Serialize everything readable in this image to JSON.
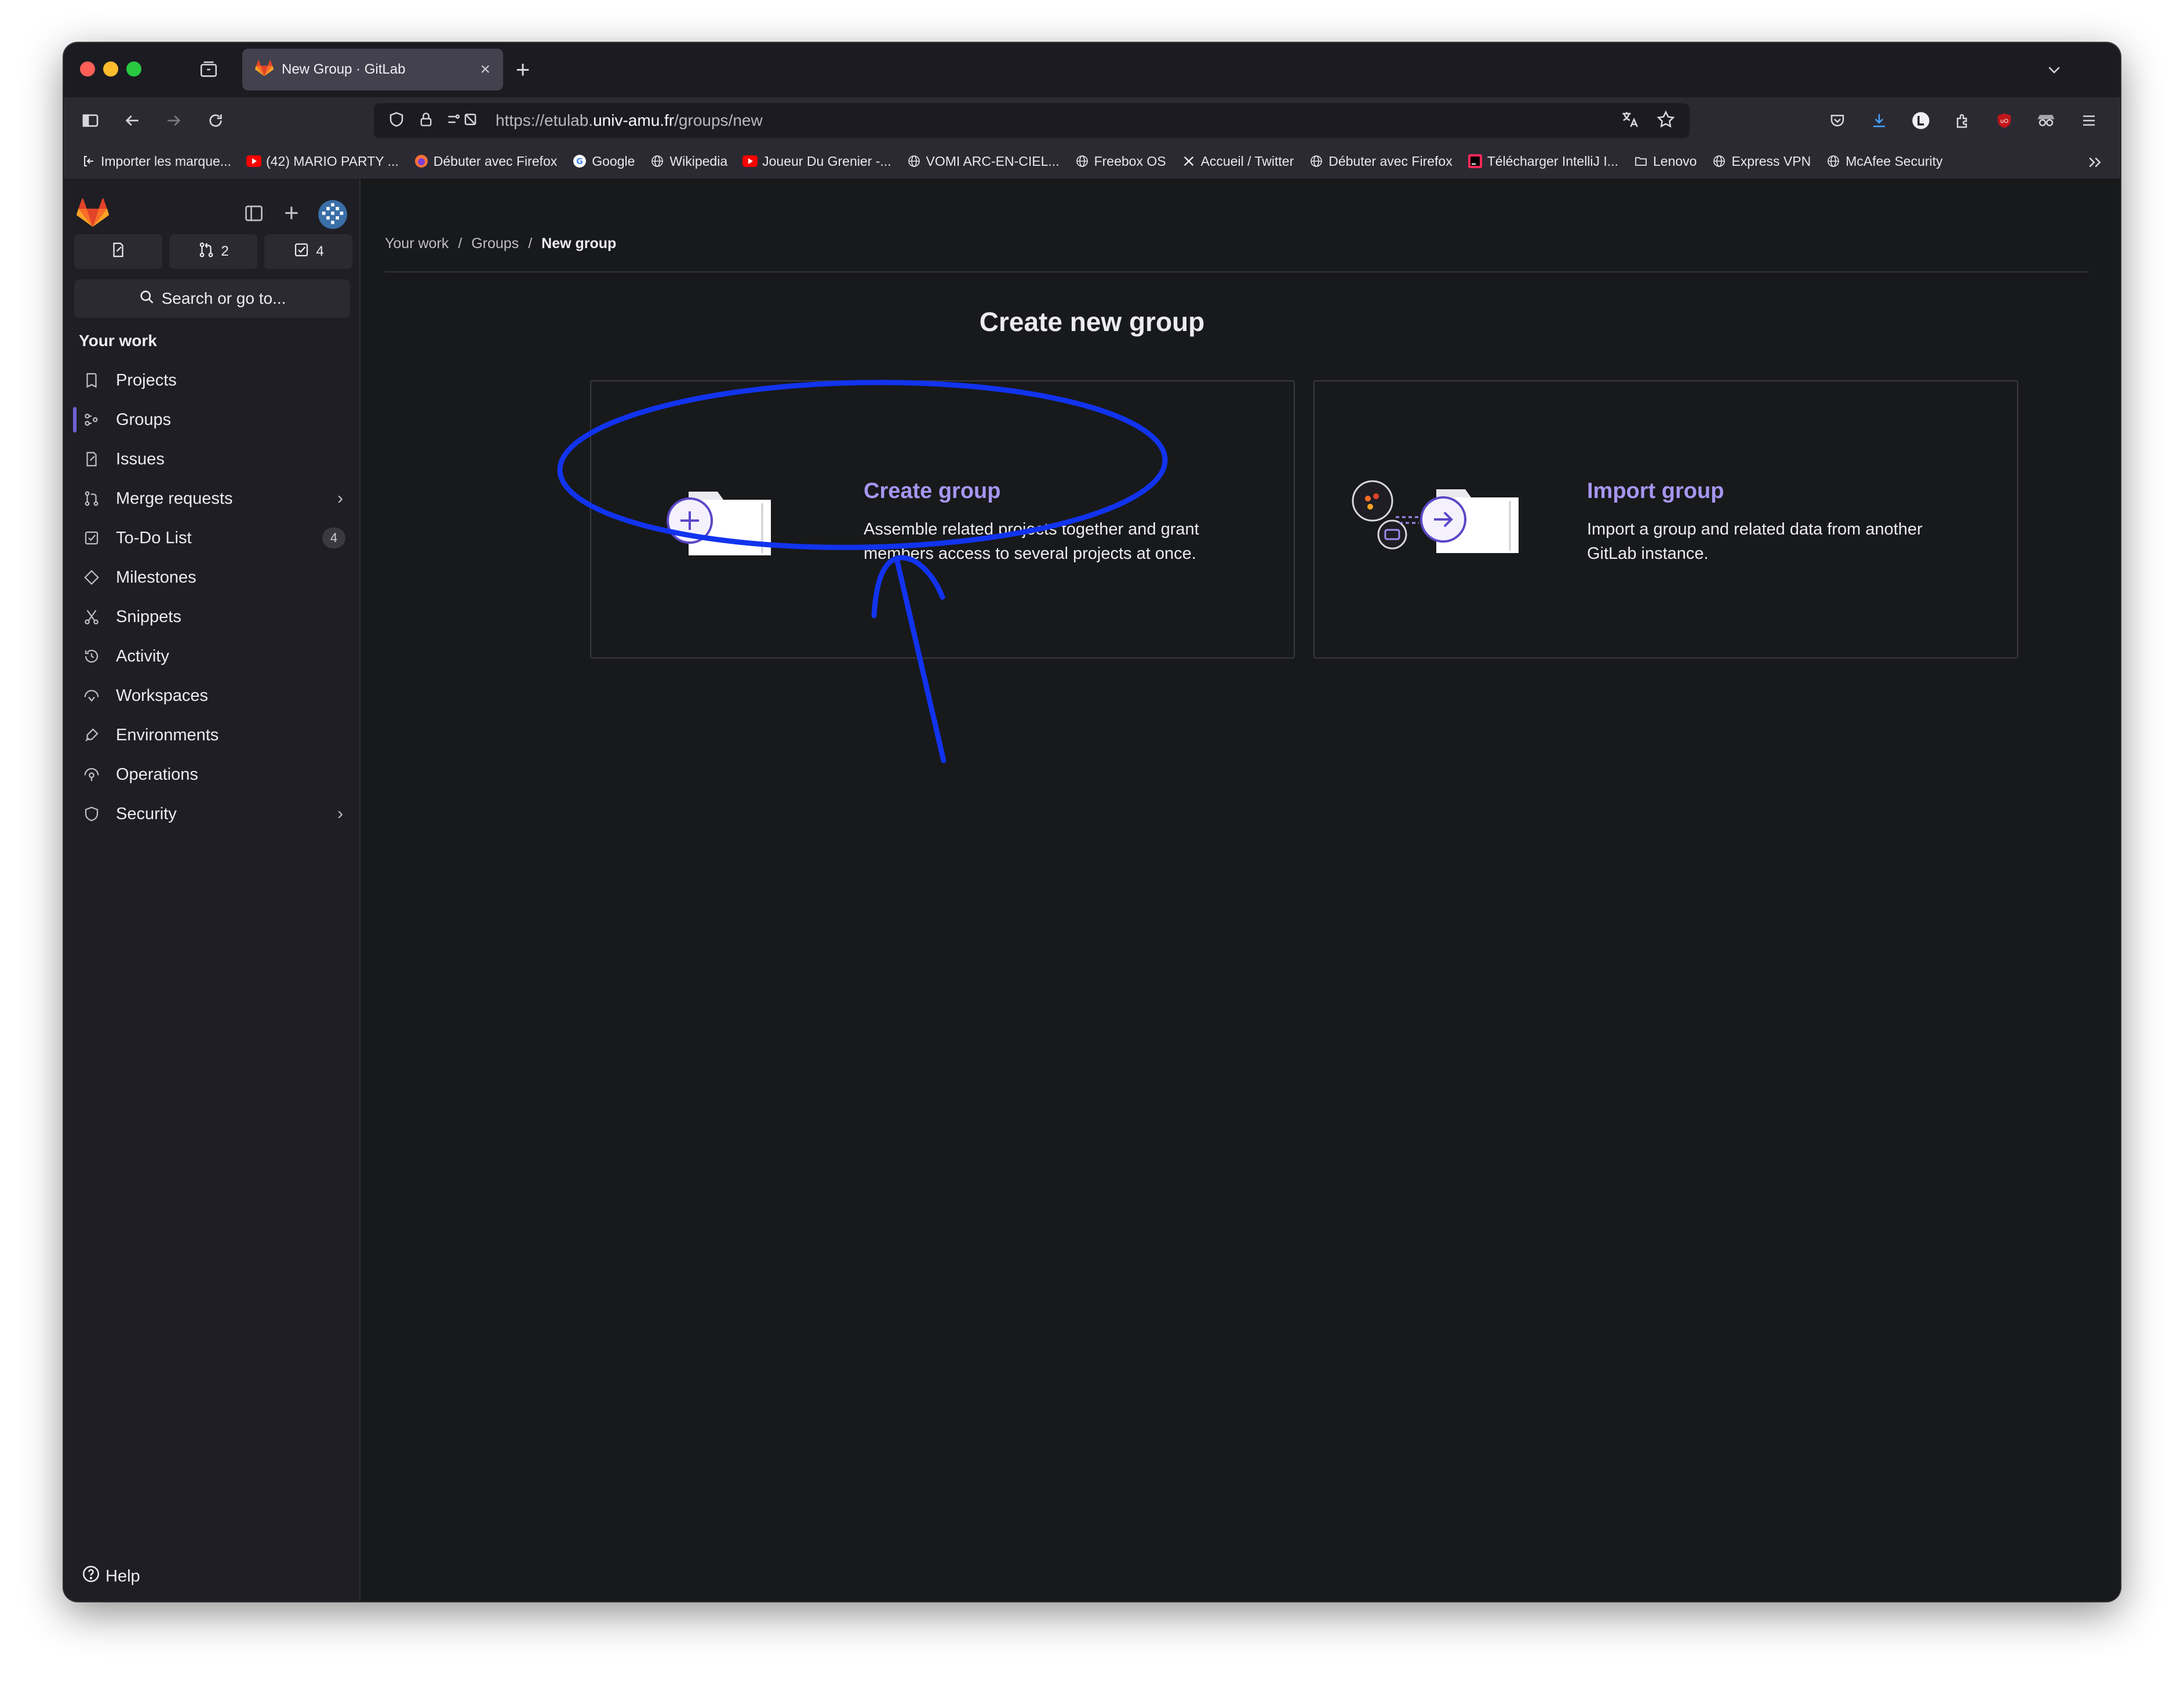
{
  "browser": {
    "tab_title": "New Group · GitLab",
    "url_prefix": "https://etulab.",
    "url_domain": "univ-amu.fr",
    "url_path": "/groups/new",
    "bookmarks": [
      {
        "label": "Importer les marque...",
        "icon": "import-icon"
      },
      {
        "label": "(42) MARIO PARTY ...",
        "icon": "youtube-icon"
      },
      {
        "label": "Débuter avec Firefox",
        "icon": "firefox-icon"
      },
      {
        "label": "Google",
        "icon": "google-icon"
      },
      {
        "label": "Wikipedia",
        "icon": "globe-icon"
      },
      {
        "label": "Joueur Du Grenier -...",
        "icon": "youtube-icon"
      },
      {
        "label": "VOMI ARC-EN-CIEL...",
        "icon": "globe-icon"
      },
      {
        "label": "Freebox OS",
        "icon": "globe-icon"
      },
      {
        "label": "Accueil / Twitter",
        "icon": "x-icon"
      },
      {
        "label": "Débuter avec Firefox",
        "icon": "globe-icon"
      },
      {
        "label": "Télécharger IntelliJ I...",
        "icon": "intellij-icon"
      },
      {
        "label": "Lenovo",
        "icon": "folder-icon"
      },
      {
        "label": "Express VPN",
        "icon": "globe-icon"
      },
      {
        "label": "McAfee Security",
        "icon": "globe-icon"
      }
    ],
    "colors": {
      "accent_annotation": "#1133ee"
    }
  },
  "sidebar": {
    "merge_requests_count": "2",
    "todo_count": "4",
    "search_label": "Search or go to...",
    "section_title": "Your work",
    "items": [
      {
        "label": "Projects",
        "icon": "project-icon"
      },
      {
        "label": "Groups",
        "icon": "group-icon"
      },
      {
        "label": "Issues",
        "icon": "issues-icon"
      },
      {
        "label": "Merge requests",
        "icon": "merge-request-icon"
      },
      {
        "label": "To-Do List",
        "icon": "todo-icon",
        "badge": "4"
      },
      {
        "label": "Milestones",
        "icon": "milestone-icon"
      },
      {
        "label": "Snippets",
        "icon": "snippet-icon"
      },
      {
        "label": "Activity",
        "icon": "history-icon"
      },
      {
        "label": "Workspaces",
        "icon": "workspace-icon"
      },
      {
        "label": "Environments",
        "icon": "environment-icon"
      },
      {
        "label": "Operations",
        "icon": "operations-icon"
      },
      {
        "label": "Security",
        "icon": "shield-icon"
      }
    ],
    "help_label": "Help"
  },
  "main": {
    "breadcrumb": [
      "Your work",
      "Groups",
      "New group"
    ],
    "title": "Create new group",
    "cards": [
      {
        "title": "Create group",
        "description": "Assemble related projects together and grant members access to several projects at once."
      },
      {
        "title": "Import group",
        "description": "Import a group and related data from another GitLab instance."
      }
    ]
  }
}
